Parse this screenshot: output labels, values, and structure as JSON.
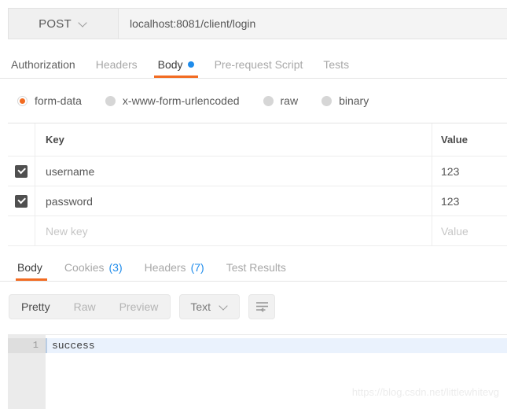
{
  "request": {
    "method": "POST",
    "method_icon": "chevron-down-icon",
    "url": "localhost:8081/client/login",
    "tabs": [
      {
        "label": "Authorization",
        "state": "dark"
      },
      {
        "label": "Headers",
        "state": "muted"
      },
      {
        "label": "Body",
        "state": "active",
        "dot": "blue-dot-icon"
      },
      {
        "label": "Pre-request Script",
        "state": "muted"
      },
      {
        "label": "Tests",
        "state": "muted"
      }
    ],
    "body_types": [
      {
        "label": "form-data",
        "selected": true
      },
      {
        "label": "x-www-form-urlencoded",
        "selected": false
      },
      {
        "label": "raw",
        "selected": false
      },
      {
        "label": "binary",
        "selected": false
      }
    ],
    "table": {
      "columns": [
        "Key",
        "Value"
      ],
      "rows": [
        {
          "checked": true,
          "key": "username",
          "value": "123"
        },
        {
          "checked": true,
          "key": "password",
          "value": "123"
        }
      ],
      "new_row": {
        "key_placeholder": "New key",
        "value_placeholder": "Value"
      }
    }
  },
  "response": {
    "tabs": [
      {
        "label": "Body",
        "count": "",
        "state": "active"
      },
      {
        "label": "Cookies",
        "count": "(3)",
        "state": "muted"
      },
      {
        "label": "Headers",
        "count": "(7)",
        "state": "muted"
      },
      {
        "label": "Test Results",
        "count": "",
        "state": "muted"
      }
    ],
    "view_modes": [
      {
        "label": "Pretty",
        "selected": true
      },
      {
        "label": "Raw",
        "selected": false
      },
      {
        "label": "Preview",
        "selected": false
      }
    ],
    "format": {
      "label": "Text",
      "icon": "chevron-down-icon"
    },
    "wrap_icon": "text-wrap-icon",
    "body": {
      "line_number": "1",
      "text": "success"
    }
  },
  "watermark": "https://blog.csdn.net/littlewhitevg",
  "colors": {
    "accent": "#f26b21",
    "info": "#1f8ceb",
    "checkbox": "#4f4f4f"
  }
}
